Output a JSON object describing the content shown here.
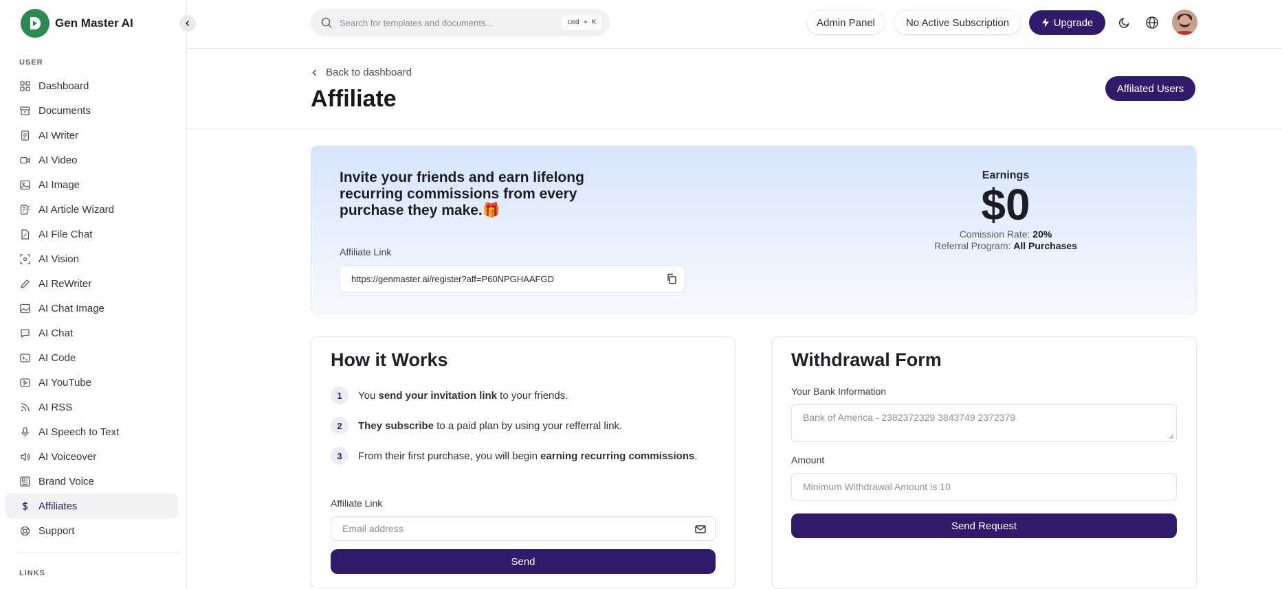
{
  "brand": {
    "name": "Gen Master AI"
  },
  "sidebar": {
    "user_label": "USER",
    "links_label": "LINKS",
    "items": [
      {
        "label": "Dashboard",
        "icon": "grid-icon"
      },
      {
        "label": "Documents",
        "icon": "archive-icon"
      },
      {
        "label": "AI Writer",
        "icon": "file-text-icon"
      },
      {
        "label": "AI Video",
        "icon": "video-icon"
      },
      {
        "label": "AI Image",
        "icon": "image-icon"
      },
      {
        "label": "AI Article Wizard",
        "icon": "article-icon"
      },
      {
        "label": "AI File Chat",
        "icon": "file-chat-icon"
      },
      {
        "label": "AI Vision",
        "icon": "scan-eye-icon"
      },
      {
        "label": "AI ReWriter",
        "icon": "pencil-icon"
      },
      {
        "label": "AI Chat Image",
        "icon": "chat-image-icon"
      },
      {
        "label": "AI Chat",
        "icon": "message-icon"
      },
      {
        "label": "AI Code",
        "icon": "terminal-icon"
      },
      {
        "label": "AI YouTube",
        "icon": "youtube-icon"
      },
      {
        "label": "AI RSS",
        "icon": "rss-icon"
      },
      {
        "label": "AI Speech to Text",
        "icon": "microphone-icon"
      },
      {
        "label": "AI Voiceover",
        "icon": "speaker-icon"
      },
      {
        "label": "Brand Voice",
        "icon": "brand-icon"
      },
      {
        "label": "Affiliates",
        "icon": "dollar-icon",
        "active": true
      },
      {
        "label": "Support",
        "icon": "lifebuoy-icon"
      }
    ]
  },
  "topbar": {
    "search_placeholder": "Search for templates and documents...",
    "search_shortcut": "cmd + K",
    "admin_panel": "Admin Panel",
    "subscription": "No Active Subscription",
    "upgrade": "Upgrade"
  },
  "page": {
    "back_label": "Back to dashboard",
    "title": "Affiliate",
    "affiliated_users": "Affilated Users"
  },
  "hero": {
    "headline": "Invite your friends and earn lifelong recurring commissions from every purchase they make.",
    "gift_emoji": "🎁",
    "affiliate_link_label": "Affiliate Link",
    "affiliate_link": "https://genmaster.ai/register?aff=P60NPGHAAFGD",
    "earnings_label": "Earnings",
    "earnings_value": "$0",
    "commission_label": "Comission Rate:",
    "commission_value": "20%",
    "referral_label": "Referral Program:",
    "referral_value": "All Purchases"
  },
  "how": {
    "title": "How it Works",
    "steps": [
      {
        "num": "1",
        "pre": "You ",
        "bold": "send your invitation link",
        "post": " to your friends."
      },
      {
        "num": "2",
        "pre": "",
        "bold": "They subscribe",
        "post": " to a paid plan by using your refferral link."
      },
      {
        "num": "3",
        "pre": "From their first purchase, you will begin ",
        "bold": "earning recurring commissions",
        "post": "."
      }
    ],
    "link_label": "Affiliate Link",
    "email_placeholder": "Email address",
    "send": "Send"
  },
  "withdraw": {
    "title": "Withdrawal Form",
    "bank_label": "Your Bank Information",
    "bank_placeholder": "Bank of America - 2382372329 3843749 2372379",
    "amount_label": "Amount",
    "amount_placeholder": "Minimum Withdrawal Amount is 10",
    "submit": "Send Request"
  },
  "colors": {
    "accent": "#2f1a6b",
    "brand_green": "#2a8a52",
    "hero_top": "#d6e6fb"
  }
}
